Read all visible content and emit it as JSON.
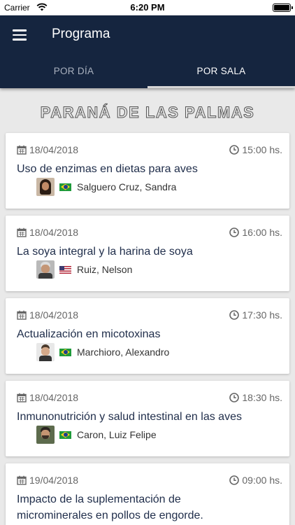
{
  "status_bar": {
    "carrier": "Carrier",
    "time": "6:20 PM"
  },
  "header": {
    "title": "Programa",
    "tabs": [
      {
        "label": "POR DÍA",
        "active": false
      },
      {
        "label": "POR SALA",
        "active": true
      }
    ]
  },
  "colors": {
    "header_bg": "#15253f",
    "title_text": "#1f2d4a",
    "page_bg": "#e9e9e9"
  },
  "section": {
    "title": "PARANÁ DE LAS PALMAS"
  },
  "sessions": [
    {
      "date": "18/04/2018",
      "time": "15:00 hs.",
      "title": "Uso de enzimas en dietas para aves",
      "speaker": "Salguero Cruz, Sandra",
      "flag": "brazil-flag"
    },
    {
      "date": "18/04/2018",
      "time": "16:00 hs.",
      "title": "La soya integral y la harina de soya",
      "speaker": "Ruiz, Nelson",
      "flag": "usa-flag"
    },
    {
      "date": "18/04/2018",
      "time": "17:30 hs.",
      "title": "Actualización en micotoxinas",
      "speaker": "Marchioro, Alexandro",
      "flag": "brazil-flag"
    },
    {
      "date": "18/04/2018",
      "time": "18:30 hs.",
      "title": "Inmunonutrición y salud intestinal en las aves",
      "speaker": "Caron, Luiz Felipe",
      "flag": "brazil-flag"
    },
    {
      "date": "19/04/2018",
      "time": "09:00 hs.",
      "title_line1": "Impacto de la suplementación de",
      "title_line2": "microminerales en pollos de engorde."
    }
  ]
}
